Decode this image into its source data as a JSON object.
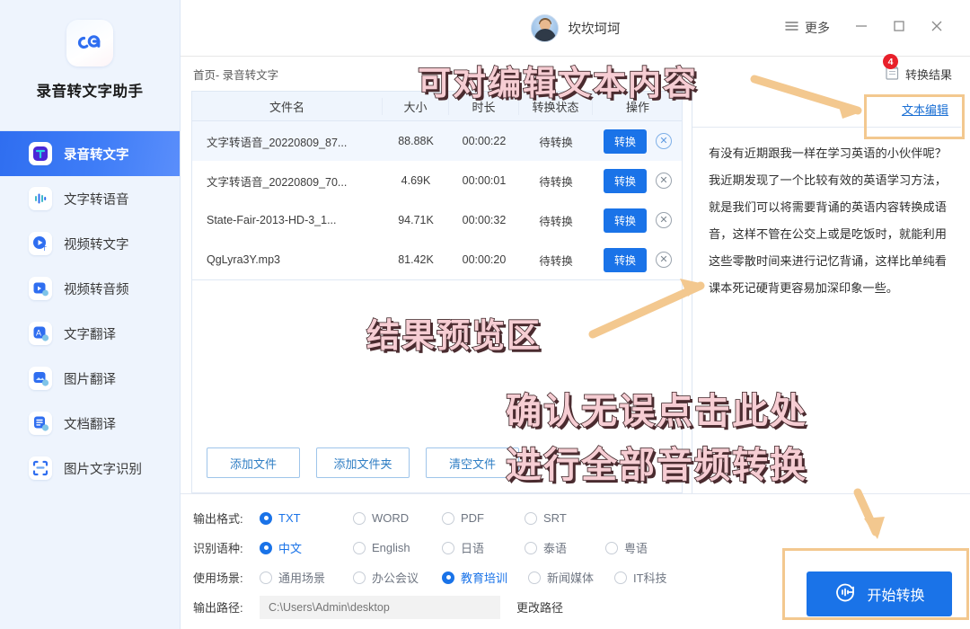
{
  "sidebar": {
    "brand_name": "录音转文字助手",
    "logo_icon": "app-logo-icon",
    "items": [
      {
        "label": "录音转文字",
        "icon": "text-to-record-icon",
        "active": true
      },
      {
        "label": "文字转语音",
        "icon": "waveform-icon",
        "active": false
      },
      {
        "label": "视频转文字",
        "icon": "video-play-icon",
        "active": false
      },
      {
        "label": "视频转音频",
        "icon": "video-audio-icon",
        "active": false
      },
      {
        "label": "文字翻译",
        "icon": "translate-a-icon",
        "active": false
      },
      {
        "label": "图片翻译",
        "icon": "image-translate-icon",
        "active": false
      },
      {
        "label": "文档翻译",
        "icon": "document-translate-icon",
        "active": false
      },
      {
        "label": "图片文字识别",
        "icon": "ocr-scan-icon",
        "active": false
      }
    ]
  },
  "titlebar": {
    "username": "坎坎坷坷",
    "avatar_icon": "user-avatar",
    "more_label": "更多",
    "more_icon": "hamburger-icon",
    "minimize_icon": "minimize-icon",
    "maximize_icon": "maximize-icon",
    "close_icon": "close-icon"
  },
  "content": {
    "breadcrumb": "首页- 录音转文字",
    "result_chip": {
      "label": "转换结果",
      "badge": "4",
      "icon": "document-result-icon"
    }
  },
  "table": {
    "columns": [
      "文件名",
      "大小",
      "时长",
      "转换状态",
      "操作"
    ],
    "rows": [
      {
        "name": "文字转语音_20220809_87...",
        "size": "88.88K",
        "duration": "00:00:22",
        "status": "待转换",
        "action": "转换",
        "delete_icon": "circle-close-icon",
        "selected": true
      },
      {
        "name": "文字转语音_20220809_70...",
        "size": "4.69K",
        "duration": "00:00:01",
        "status": "待转换",
        "action": "转换",
        "delete_icon": "circle-close-icon",
        "selected": false
      },
      {
        "name": "State-Fair-2013-HD-3_1...",
        "size": "94.71K",
        "duration": "00:00:32",
        "status": "待转换",
        "action": "转换",
        "delete_icon": "circle-close-icon",
        "selected": false
      },
      {
        "name": "QgLyra3Y.mp3",
        "size": "81.42K",
        "duration": "00:00:20",
        "status": "待转换",
        "action": "转换",
        "delete_icon": "circle-close-icon",
        "selected": false
      }
    ]
  },
  "file_actions": {
    "add_file": "添加文件",
    "add_folder": "添加文件夹",
    "clear_files": "清空文件"
  },
  "preview": {
    "edit_link": "文本编辑",
    "text": "有没有近期跟我一样在学习英语的小伙伴呢？我近期发现了一个比较有效的英语学习方法，就是我们可以将需要背诵的英语内容转换成语音，这样不管在公交上或是吃饭时，就能利用这些零散时间来进行记忆背诵，这样比单纯看课本死记硬背更容易加深印象一些。"
  },
  "settings": {
    "output_format": {
      "label": "输出格式:",
      "options": [
        "TXT",
        "WORD",
        "PDF",
        "SRT"
      ],
      "selected": "TXT"
    },
    "language": {
      "label": "识别语种:",
      "options": [
        "中文",
        "English",
        "日语",
        "泰语",
        "粤语"
      ],
      "selected": "中文"
    },
    "scene": {
      "label": "使用场景:",
      "options": [
        "通用场景",
        "办公会议",
        "教育培训",
        "新闻媒体",
        "IT科技"
      ],
      "selected": "教育培训"
    },
    "output_path": {
      "label": "输出路径:",
      "placeholder": "C:\\Users\\Admin\\desktop",
      "value": "",
      "change_link": "更改路径"
    }
  },
  "start_button": {
    "label": "开始转换",
    "icon": "convert-circle-icon"
  },
  "annotations": {
    "top": "可对编辑文本内容",
    "middle": "结果预览区",
    "bottom_line1": "确认无误点击此处",
    "bottom_line2": "进行全部音频转换"
  },
  "colors": {
    "accent_blue": "#1a73e8",
    "sidebar_bg": "#eef4fd",
    "badge_red": "#e8202a",
    "annotation_pink": "#f6cdd3",
    "highlight_orange": "#f3c88f"
  }
}
